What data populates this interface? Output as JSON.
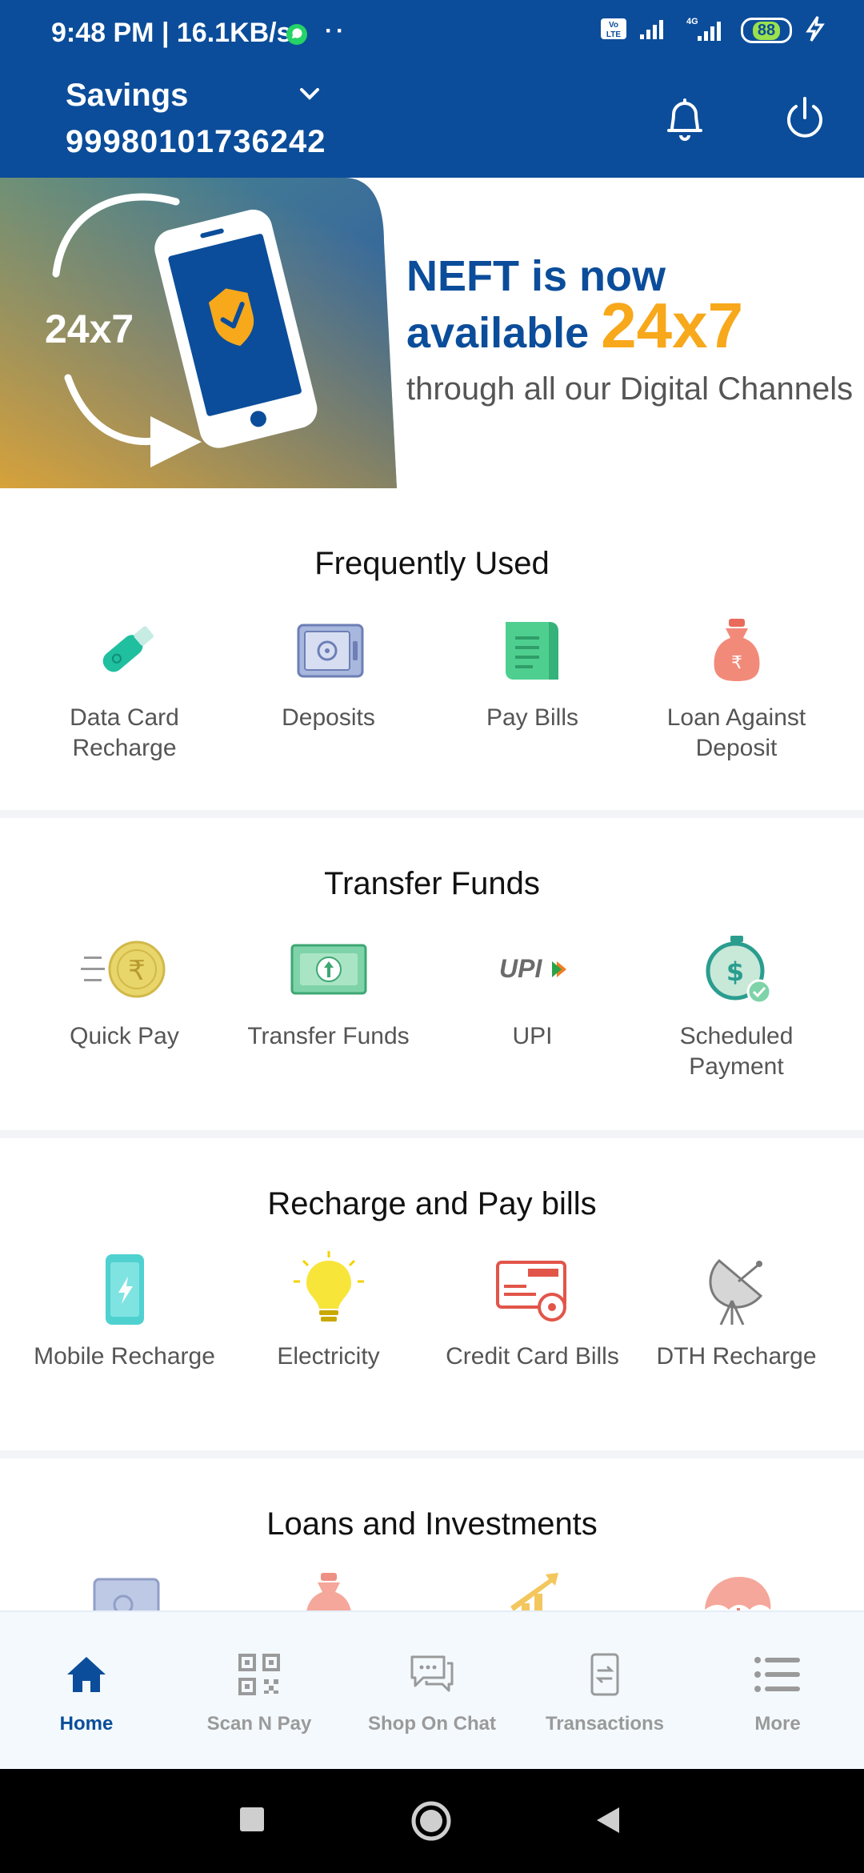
{
  "status_bar": {
    "time": "9:48 PM | 16.1KB/s",
    "dots": "··",
    "battery": "88"
  },
  "header": {
    "account_type": "Savings",
    "account_number": "99980101736242"
  },
  "banner": {
    "badge": "24x7",
    "title_line1": "NEFT is now",
    "title_line2_a": "available ",
    "title_line2_b": "24x7",
    "subtitle": "through all our Digital Channels"
  },
  "sections": [
    {
      "title": "Frequently Used",
      "items": [
        {
          "label": "Data Card Recharge",
          "icon": "usb-stick-icon"
        },
        {
          "label": "Deposits",
          "icon": "safe-icon"
        },
        {
          "label": "Pay Bills",
          "icon": "bill-scroll-icon"
        },
        {
          "label": "Loan Against Deposit",
          "icon": "money-bag-icon"
        }
      ]
    },
    {
      "title": "Transfer Funds",
      "items": [
        {
          "label": "Quick Pay",
          "icon": "rupee-coin-icon"
        },
        {
          "label": "Transfer Funds",
          "icon": "banknote-icon"
        },
        {
          "label": "UPI",
          "icon": "upi-logo-icon"
        },
        {
          "label": "Scheduled Payment",
          "icon": "stopwatch-dollar-icon"
        }
      ]
    },
    {
      "title": "Recharge and Pay bills",
      "items": [
        {
          "label": "Mobile Recharge",
          "icon": "mobile-icon"
        },
        {
          "label": "Electricity",
          "icon": "bulb-icon"
        },
        {
          "label": "Credit Card Bills",
          "icon": "credit-card-icon"
        },
        {
          "label": "DTH Recharge",
          "icon": "satellite-dish-icon"
        }
      ]
    },
    {
      "title": "Loans and Investments",
      "items": []
    }
  ],
  "bottom_nav": [
    {
      "label": "Home",
      "icon": "home-icon"
    },
    {
      "label": "Scan N Pay",
      "icon": "qr-code-icon"
    },
    {
      "label": "Shop On Chat",
      "icon": "chat-icon"
    },
    {
      "label": "Transactions",
      "icon": "transactions-icon"
    },
    {
      "label": "More",
      "icon": "menu-icon"
    }
  ],
  "colors": {
    "brand": "#0b4d9a",
    "accent": "#f7a81b"
  }
}
